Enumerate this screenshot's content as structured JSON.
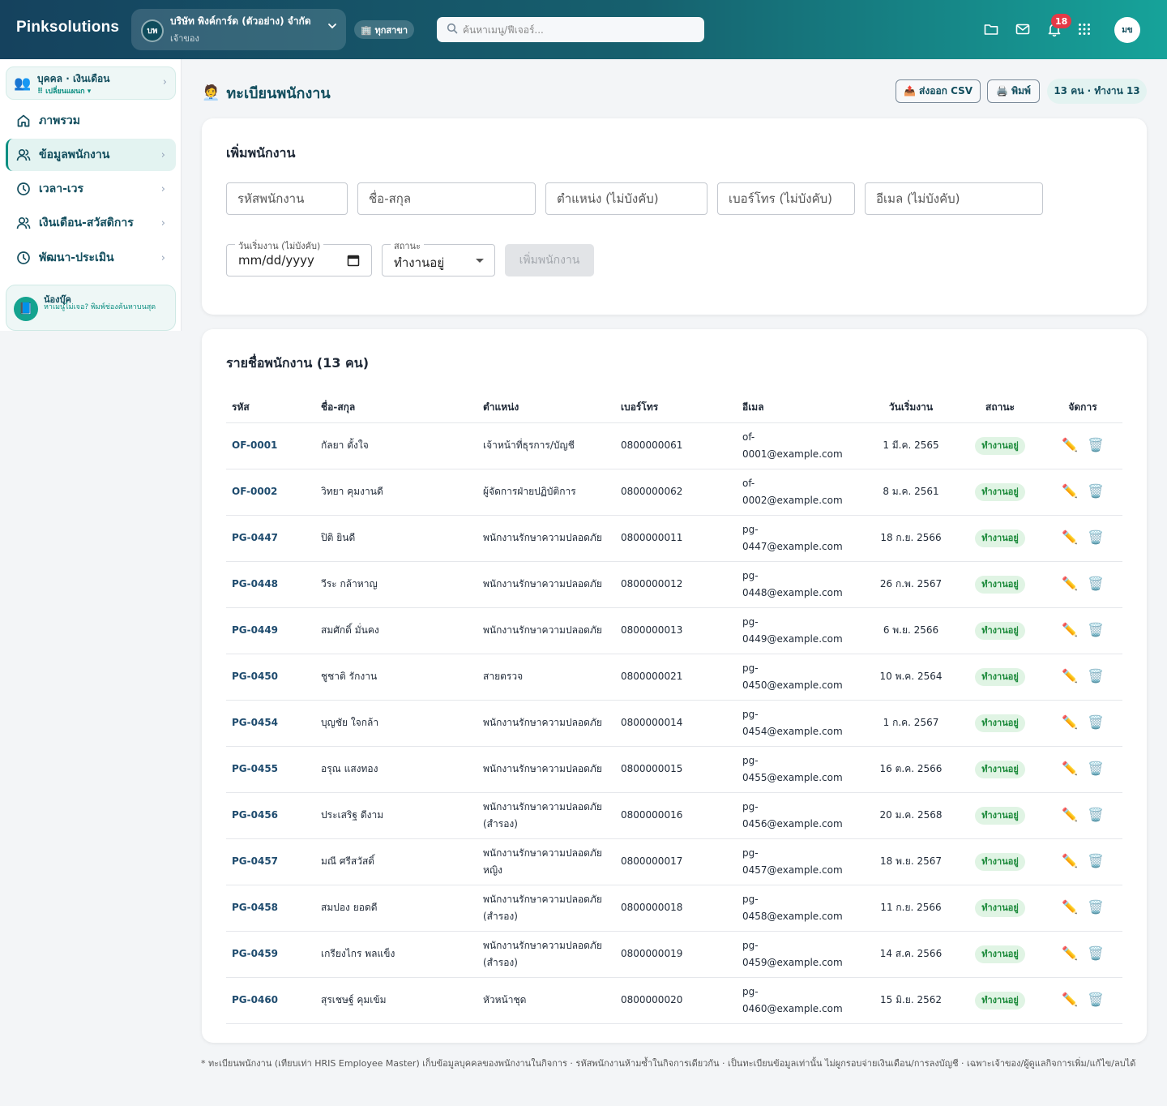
{
  "topbar": {
    "brand": "Pinksolutions",
    "company": {
      "avatar": "บพ",
      "name": "บริษัท พิงค์การ์ด (ตัวอย่าง) จำกัด",
      "role": "เจ้าของ"
    },
    "branch": "🏢 ทุกสาขา",
    "search_placeholder": "ค้นหาเมนู/ฟีเจอร์...",
    "notifications": "18",
    "user_initials": "มข",
    "icons": [
      "folder-icon",
      "mail-icon",
      "bell-icon",
      "apps-grid-icon"
    ]
  },
  "sidebar": {
    "module": {
      "icon": "👥",
      "title": "บุคคล · เงินเดือน",
      "subtitle": "⠿ เปลี่ยนแผนก ▾"
    },
    "items": [
      {
        "label": "ภาพรวม",
        "icon": "home-icon",
        "chevron": false,
        "active": false
      },
      {
        "label": "ข้อมูลพนักงาน",
        "icon": "users-icon",
        "chevron": true,
        "active": true
      },
      {
        "label": "เวลา-เวร",
        "icon": "clock-icon",
        "chevron": true,
        "active": false
      },
      {
        "label": "เงินเดือน-สวัสดิการ",
        "icon": "users-icon",
        "chevron": true,
        "active": false
      },
      {
        "label": "พัฒนา-ประเมิน",
        "icon": "clock-icon",
        "chevron": true,
        "active": false
      }
    ],
    "helper": {
      "title": "น้องบุ๊ค",
      "text": "หาเมนูไม่เจอ? พิมพ์ช่องค้นหาบนสุด"
    }
  },
  "header": {
    "title": "ทะเบียนพนักงาน",
    "title_icon": "🧑‍💼",
    "export_csv": "📤 ส่งออก CSV",
    "print": "🖨️ พิมพ์",
    "count_pill": "13 คน · ทำงาน 13"
  },
  "form": {
    "title": "เพิ่มพนักงาน",
    "placeholders": {
      "code": "รหัสพนักงาน",
      "name": "ชื่อ-สกุล",
      "position": "ตำแหน่ง (ไม่บังคับ)",
      "phone": "เบอร์โทร (ไม่บังคับ)",
      "email": "อีเมล (ไม่บังคับ)"
    },
    "start_date_label": "วันเริ่มงาน (ไม่บังคับ)",
    "start_date_value": "mm/dd/yyyy",
    "status_label": "สถานะ",
    "status_value": "ทำงานอยู่",
    "submit": "เพิ่มพนักงาน"
  },
  "list": {
    "title": "รายชื่อพนักงาน (13 คน)",
    "columns": [
      "รหัส",
      "ชื่อ-สกุล",
      "ตำแหน่ง",
      "เบอร์โทร",
      "อีเมล",
      "วันเริ่มงาน",
      "สถานะ",
      "จัดการ"
    ],
    "rows": [
      {
        "code": "OF-0001",
        "name": "กัลยา ตั้งใจ",
        "position": "เจ้าหน้าที่ธุรการ/บัญชี",
        "phone": "0800000061",
        "email_1": "of-",
        "email_2": "0001@example.com",
        "start": "1 มี.ค. 2565",
        "status": "ทำงานอยู่"
      },
      {
        "code": "OF-0002",
        "name": "วิทยา คุมงานดี",
        "position": "ผู้จัดการฝ่ายปฏิบัติการ",
        "phone": "0800000062",
        "email_1": "of-",
        "email_2": "0002@example.com",
        "start": "8 ม.ค. 2561",
        "status": "ทำงานอยู่"
      },
      {
        "code": "PG-0447",
        "name": "ปิติ ยินดี",
        "position": "พนักงานรักษาความปลอดภัย",
        "phone": "0800000011",
        "email_1": "pg-",
        "email_2": "0447@example.com",
        "start": "18 ก.ย. 2566",
        "status": "ทำงานอยู่"
      },
      {
        "code": "PG-0448",
        "name": "วีระ กล้าหาญ",
        "position": "พนักงานรักษาความปลอดภัย",
        "phone": "0800000012",
        "email_1": "pg-",
        "email_2": "0448@example.com",
        "start": "26 ก.พ. 2567",
        "status": "ทำงานอยู่"
      },
      {
        "code": "PG-0449",
        "name": "สมศักดิ์ มั่นคง",
        "position": "พนักงานรักษาความปลอดภัย",
        "phone": "0800000013",
        "email_1": "pg-",
        "email_2": "0449@example.com",
        "start": "6 พ.ย. 2566",
        "status": "ทำงานอยู่"
      },
      {
        "code": "PG-0450",
        "name": "ชูชาติ รักงาน",
        "position": "สายตรวจ",
        "phone": "0800000021",
        "email_1": "pg-",
        "email_2": "0450@example.com",
        "start": "10 พ.ค. 2564",
        "status": "ทำงานอยู่"
      },
      {
        "code": "PG-0454",
        "name": "บุญชัย ใจกล้า",
        "position": "พนักงานรักษาความปลอดภัย",
        "phone": "0800000014",
        "email_1": "pg-",
        "email_2": "0454@example.com",
        "start": "1 ก.ค. 2567",
        "status": "ทำงานอยู่"
      },
      {
        "code": "PG-0455",
        "name": "อรุณ แสงทอง",
        "position": "พนักงานรักษาความปลอดภัย",
        "phone": "0800000015",
        "email_1": "pg-",
        "email_2": "0455@example.com",
        "start": "16 ต.ค. 2566",
        "status": "ทำงานอยู่"
      },
      {
        "code": "PG-0456",
        "name": "ประเสริฐ ดีงาม",
        "position": "พนักงานรักษาความปลอดภัย (สำรอง)",
        "phone": "0800000016",
        "email_1": "pg-",
        "email_2": "0456@example.com",
        "start": "20 ม.ค. 2568",
        "status": "ทำงานอยู่"
      },
      {
        "code": "PG-0457",
        "name": "มณี ศรีสวัสดิ์",
        "position": "พนักงานรักษาความปลอดภัย หญิง",
        "phone": "0800000017",
        "email_1": "pg-",
        "email_2": "0457@example.com",
        "start": "18 พ.ย. 2567",
        "status": "ทำงานอยู่"
      },
      {
        "code": "PG-0458",
        "name": "สมปอง ยอดดี",
        "position": "พนักงานรักษาความปลอดภัย (สำรอง)",
        "phone": "0800000018",
        "email_1": "pg-",
        "email_2": "0458@example.com",
        "start": "11 ก.ย. 2566",
        "status": "ทำงานอยู่"
      },
      {
        "code": "PG-0459",
        "name": "เกรียงไกร พลแข็ง",
        "position": "พนักงานรักษาความปลอดภัย (สำรอง)",
        "phone": "0800000019",
        "email_1": "pg-",
        "email_2": "0459@example.com",
        "start": "14 ส.ค. 2566",
        "status": "ทำงานอยู่"
      },
      {
        "code": "PG-0460",
        "name": "สุรเชษฐ์ คุมเข้ม",
        "position": "หัวหน้าชุด",
        "phone": "0800000020",
        "email_1": "pg-",
        "email_2": "0460@example.com",
        "start": "15 มิ.ย. 2562",
        "status": "ทำงานอยู่"
      }
    ],
    "edit_icon": "✏️",
    "delete_icon": "🗑️"
  },
  "footnote": "* ทะเบียนพนักงาน (เทียบเท่า HRIS Employee Master) เก็บข้อมูลบุคคลของพนักงานในกิจการ · รหัสพนักงานห้ามซ้ำในกิจการเดียวกัน · เป็นทะเบียนข้อมูลเท่านั้น ไม่ผูกรอบจ่ายเงินเดือน/การลงบัญชี · เฉพาะเจ้าของ/ผู้ดูแลกิจการเพิ่ม/แก้ไข/ลบได้"
}
